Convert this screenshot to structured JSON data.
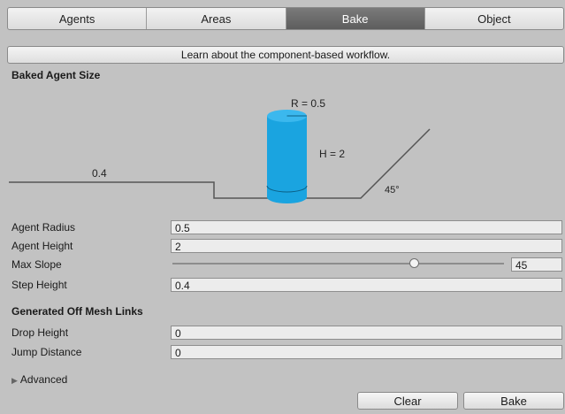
{
  "tabs": [
    "Agents",
    "Areas",
    "Bake",
    "Object"
  ],
  "active_tab": "Bake",
  "learn_button": "Learn about the component-based workflow.",
  "baked_agent_size": {
    "title": "Baked Agent Size",
    "radius_label": "R = 0.5",
    "height_label": "H = 2",
    "step_label": "0.4",
    "slope_label": "45°"
  },
  "fields": {
    "agent_radius": {
      "label": "Agent Radius",
      "value": "0.5"
    },
    "agent_height": {
      "label": "Agent Height",
      "value": "2"
    },
    "max_slope": {
      "label": "Max Slope",
      "value": "45",
      "slider_fraction": 0.73
    },
    "step_height": {
      "label": "Step Height",
      "value": "0.4"
    }
  },
  "off_mesh": {
    "title": "Generated Off Mesh Links",
    "drop_height": {
      "label": "Drop Height",
      "value": "0"
    },
    "jump_distance": {
      "label": "Jump Distance",
      "value": "0"
    }
  },
  "advanced_label": "Advanced",
  "buttons": {
    "clear": "Clear",
    "bake": "Bake"
  },
  "colors": {
    "agent_cylinder": "#1aa4e0",
    "active_tab": "#666666"
  }
}
